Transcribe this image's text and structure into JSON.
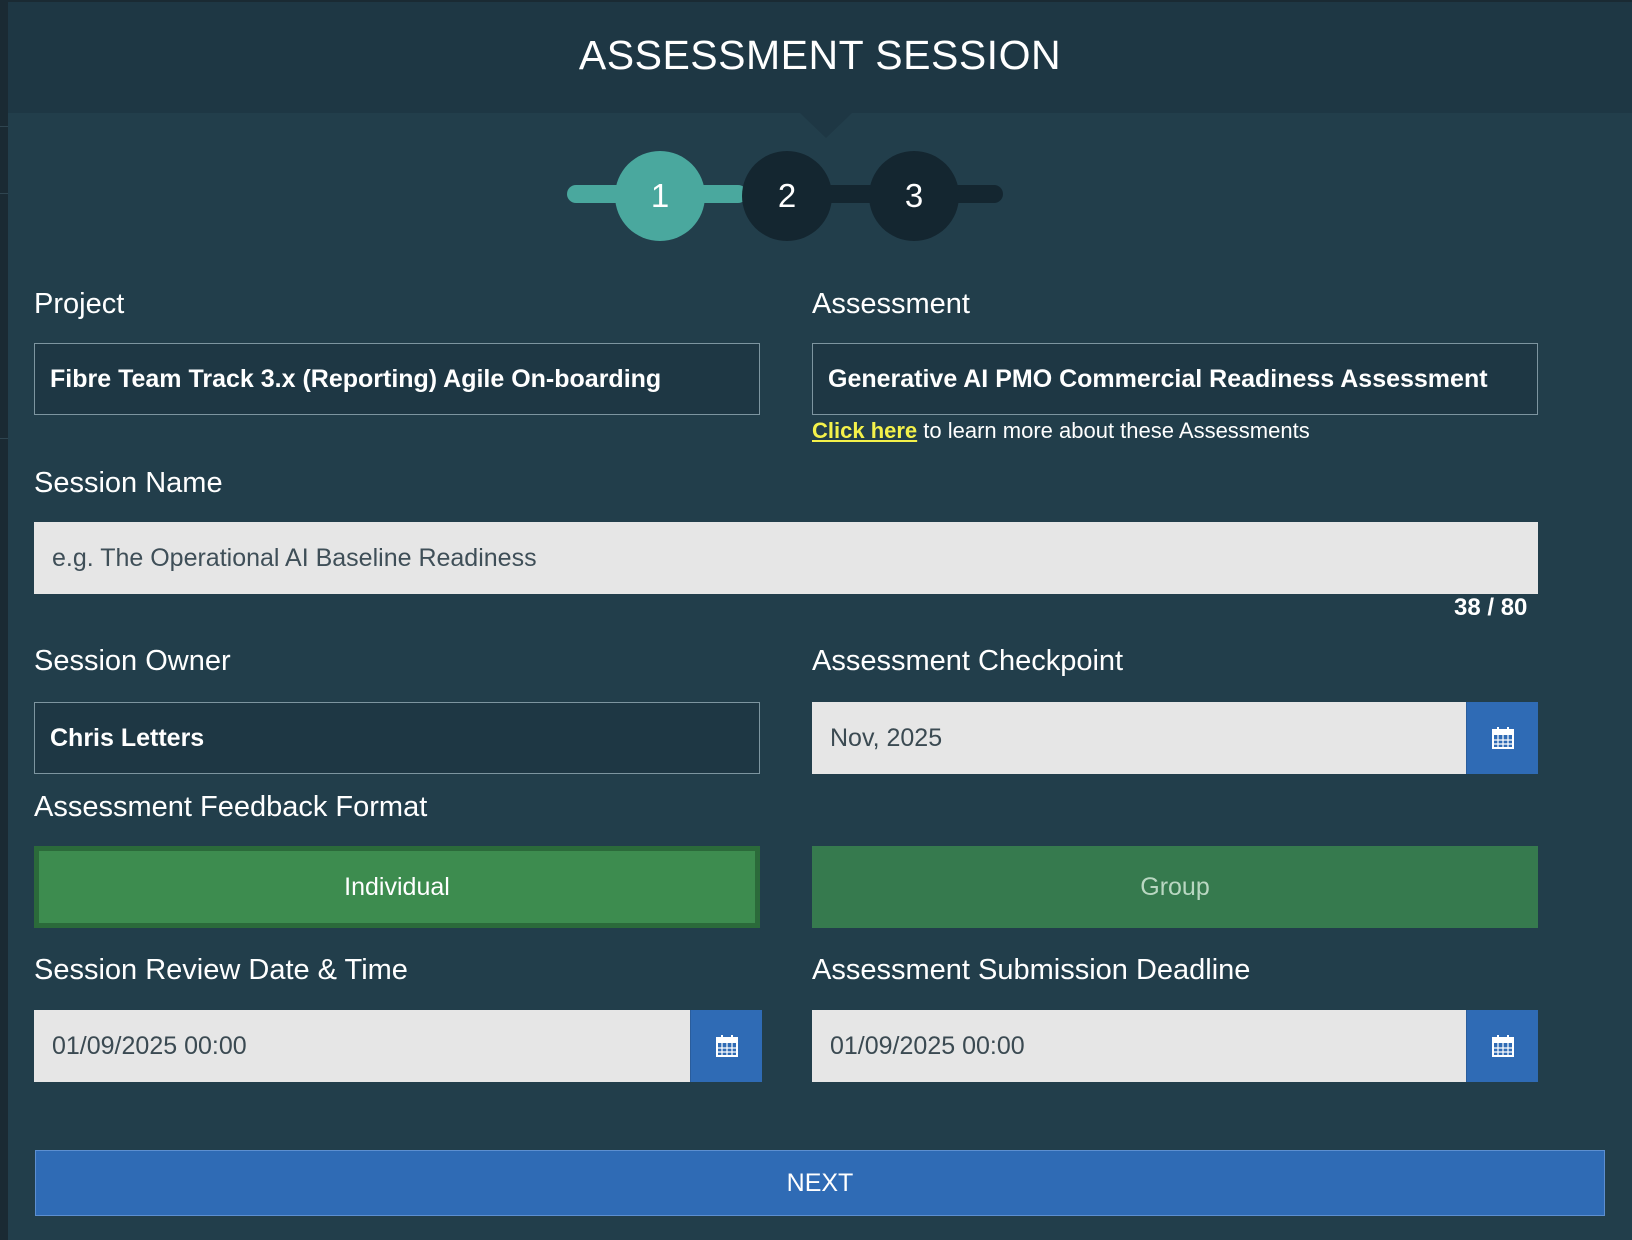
{
  "modal": {
    "title": "ASSESSMENT SESSION"
  },
  "stepper": {
    "steps": [
      "1",
      "2",
      "3"
    ],
    "active_step": 1,
    "colors": {
      "active": "#4aa89e",
      "inactive": "#142630"
    }
  },
  "project": {
    "label": "Project",
    "value": "Fibre Team Track 3.x (Reporting) Agile On-boarding"
  },
  "assessment": {
    "label": "Assessment",
    "value": "Generative AI PMO Commercial Readiness Assessment",
    "help_link": "Click here",
    "help_text": " to learn more about these Assessments"
  },
  "session_name": {
    "label": "Session Name",
    "placeholder": "e.g. The Operational AI Baseline Readiness",
    "counter": "38 / 80"
  },
  "session_owner": {
    "label": "Session Owner",
    "value": "Chris Letters"
  },
  "checkpoint": {
    "label": "Assessment Checkpoint",
    "value": "Nov, 2025",
    "icon": "calendar-icon"
  },
  "feedback_format": {
    "label": "Assessment Feedback Format",
    "options": [
      "Individual",
      "Group"
    ],
    "selected": "Individual",
    "colors": {
      "selected": "#3d8c4f",
      "unselected": "#367a4e"
    }
  },
  "review_datetime": {
    "label": "Session Review Date & Time",
    "value": "01/09/2025 00:00",
    "icon": "calendar-icon"
  },
  "submission_deadline": {
    "label": "Assessment Submission Deadline",
    "value": "01/09/2025 00:00",
    "icon": "calendar-icon"
  },
  "next_button": {
    "label": "NEXT",
    "color": "#2f6bb5"
  },
  "colors": {
    "background": "#223e4b",
    "header": "#1e3744",
    "link": "#f4f14a"
  }
}
